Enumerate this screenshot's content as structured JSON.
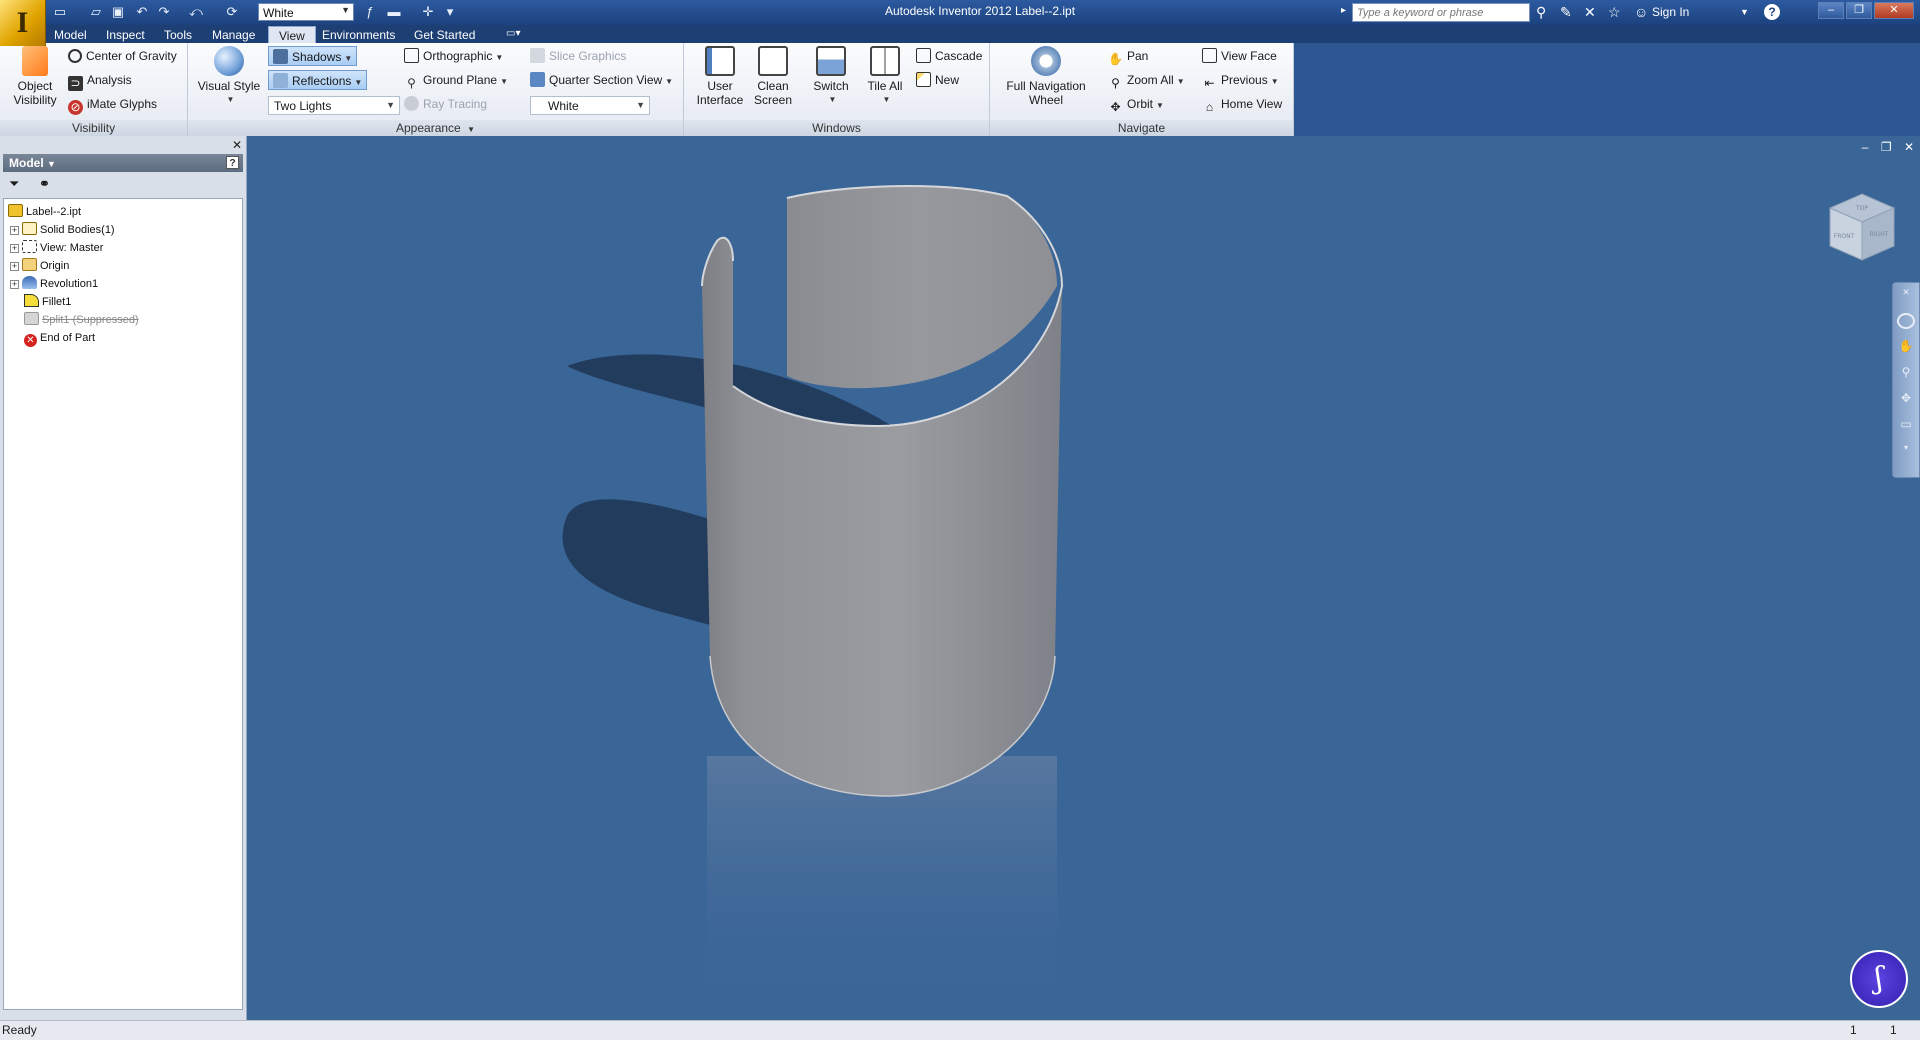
{
  "app": {
    "logo_letter": "I",
    "window_title": "Autodesk Inventor 2012    Label--2.ipt"
  },
  "quick_access": {
    "style_value": "White"
  },
  "search": {
    "placeholder": "Type a keyword or phrase"
  },
  "account": {
    "sign_in": "Sign In"
  },
  "ribbon_tabs": [
    "Model",
    "Inspect",
    "Tools",
    "Manage",
    "View",
    "Environments",
    "Get Started"
  ],
  "active_tab": "View",
  "ribbon": {
    "visibility": {
      "label": "Visibility",
      "object_visibility": "Object\nVisibility",
      "center_of_gravity": "Center of Gravity",
      "analysis": "Analysis",
      "imate_glyphs": "iMate Glyphs"
    },
    "appearance": {
      "label": "Appearance",
      "visual_style": "Visual Style",
      "shadows": "Shadows",
      "reflections": "Reflections",
      "lighting": "Two Lights",
      "orthographic": "Orthographic",
      "ground_plane": "Ground Plane",
      "ray_tracing": "Ray Tracing",
      "slice_graphics": "Slice Graphics",
      "quarter_section_view": "Quarter Section View",
      "color_override": "White"
    },
    "windows": {
      "label": "Windows",
      "user_interface": "User\nInterface",
      "clean_screen": "Clean\nScreen",
      "switch": "Switch",
      "tile_all": "Tile All",
      "cascade": "Cascade",
      "new": "New"
    },
    "navigate": {
      "label": "Navigate",
      "full_navigation_wheel": "Full Navigation\nWheel",
      "pan": "Pan",
      "zoom_all": "Zoom All",
      "orbit": "Orbit",
      "view_face": "View Face",
      "previous": "Previous",
      "home_view": "Home View"
    }
  },
  "browser": {
    "title": "Model",
    "tree": [
      {
        "label": "Label--2.ipt",
        "expandable": false,
        "icon": "part-icon"
      },
      {
        "label": "Solid Bodies(1)",
        "expandable": true,
        "icon": "solid-bodies-icon"
      },
      {
        "label": "View: Master",
        "expandable": true,
        "icon": "view-icon"
      },
      {
        "label": "Origin",
        "expandable": true,
        "icon": "folder-icon"
      },
      {
        "label": "Revolution1",
        "expandable": true,
        "icon": "revolve-icon"
      },
      {
        "label": "Fillet1",
        "expandable": false,
        "icon": "fillet-icon"
      },
      {
        "label": "Split1 (Suppressed)",
        "expandable": false,
        "icon": "split-icon",
        "suppressed": true
      },
      {
        "label": "End of Part",
        "expandable": false,
        "icon": "end-of-part-icon"
      }
    ]
  },
  "viewcube": {
    "top": "TOP",
    "front": "FRONT",
    "right": "RIGHT"
  },
  "status": {
    "text": "Ready",
    "count_a": "1",
    "count_b": "1"
  },
  "colors": {
    "viewport_bg": "#3a6597",
    "model_gray": "#8a8c90",
    "shadow": "#1f3552"
  }
}
